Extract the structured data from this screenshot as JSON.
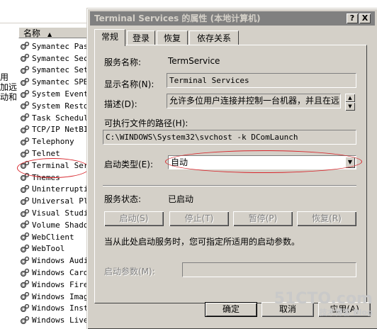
{
  "background_list": {
    "column_header": "名称",
    "left_fragments": [
      "用",
      "加远",
      "动和"
    ],
    "services": [
      "Symantec Password",
      "Symantec Security",
      "Symantec Settings",
      "Symantec SPBBC",
      "System Event",
      "System Restore",
      "Task Scheduler",
      "TCP/IP NetBIOS",
      "Telephony",
      "Telnet",
      "Terminal Services",
      "Themes",
      "Uninterruptible",
      "Universal Plug",
      "Visual Studio",
      "Volume Shadow",
      "WebClient",
      "WebTool",
      "Windows Audio",
      "Windows CardSpace",
      "Windows Firewall",
      "Windows Image",
      "Windows Installer",
      "Windows Live"
    ]
  },
  "dialog": {
    "title": "Terminal Services 的属性 (本地计算机)",
    "help_button": "?",
    "close_button": "X",
    "tabs": [
      "常规",
      "登录",
      "恢复",
      "依存关系"
    ],
    "service_name_label": "服务名称:",
    "service_name_value": "TermService",
    "display_name_label": "显示名称(N):",
    "display_name_value": "Terminal Services",
    "description_label": "描述(D):",
    "description_value": "允许多位用户连接并控制一台机器，并且在远",
    "exe_path_label": "可执行文件的路径(H):",
    "exe_path_value": "C:\\WINDOWS\\System32\\svchost -k DComLaunch",
    "startup_type_label": "启动类型(E):",
    "startup_type_value": "自动",
    "service_status_label": "服务状态:",
    "service_status_value": "已启动",
    "buttons": {
      "start": "启动(S)",
      "stop": "停止(T)",
      "pause": "暂停(P)",
      "resume": "恢复(R)"
    },
    "hint": "当从此处启动服务时，您可指定所适用的启动参数。",
    "start_params_label": "启动参数(M):",
    "start_params_value": "",
    "ok": "确定",
    "cancel": "取消",
    "apply": "应用(A)"
  },
  "watermark": {
    "line1": "51CTO.com",
    "line2": "技术博客  Blog"
  },
  "colors": {
    "dialog_face": "#d4d0c8",
    "titlebar_inactive": "#808080",
    "annotation_red": "#d8262c"
  }
}
